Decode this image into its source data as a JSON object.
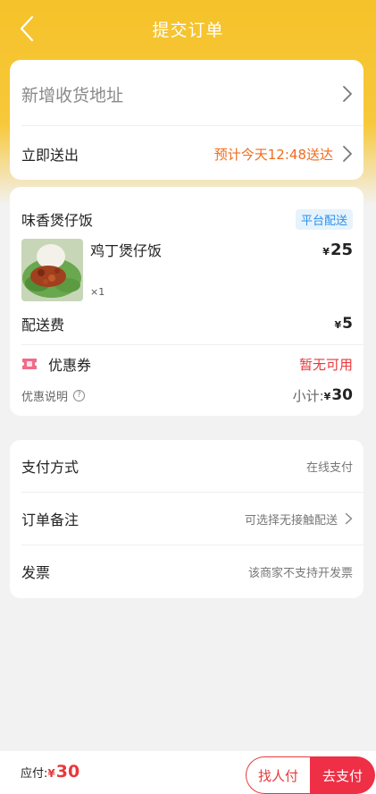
{
  "header": {
    "title": "提交订单"
  },
  "address": {
    "placeholder": "新增收货地址"
  },
  "delivery": {
    "label": "立即送出",
    "eta": "预计今天12:48送达"
  },
  "shop": {
    "name": "味香煲仔饭",
    "badge": "平台配送"
  },
  "item": {
    "name": "鸡丁煲仔饭",
    "qty": "×1",
    "currency": "¥",
    "price": "25"
  },
  "fee": {
    "label": "配送费",
    "currency": "¥",
    "value": "5"
  },
  "coupon": {
    "label": "优惠券",
    "value": "暂无可用"
  },
  "subtotal": {
    "desc_label": "优惠说明",
    "qmark": "?",
    "label": "小计:",
    "currency": "¥",
    "value": "30"
  },
  "options": {
    "payment": {
      "label": "支付方式",
      "value": "在线支付"
    },
    "note": {
      "label": "订单备注",
      "value": "可选择无接触配送"
    },
    "invoice": {
      "label": "发票",
      "value": "该商家不支持开发票"
    }
  },
  "bottom": {
    "due_label": "应付:",
    "currency": "¥",
    "due_value": "30",
    "find_button": "找人付",
    "pay_button": "去支付"
  },
  "colors": {
    "accent": "#f5c22a",
    "price_red": "#e8383b",
    "eta_orange": "#f26b1d",
    "badge_blue": "#2e8fe6"
  },
  "icons": {
    "back": "chevron-left-icon",
    "chevron": "chevron-right-icon",
    "coupon": "coupon-ticket-icon",
    "help": "question-circle-icon"
  }
}
